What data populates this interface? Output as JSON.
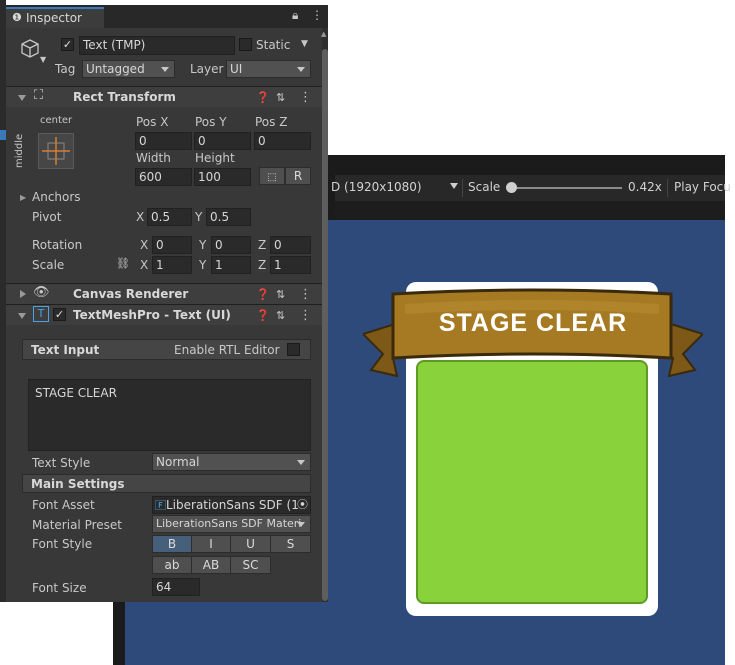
{
  "inspector": {
    "tab_label": "Inspector",
    "object": {
      "name": "Text (TMP)",
      "static_label": "Static",
      "tag_label": "Tag",
      "tag_value": "Untagged",
      "layer_label": "Layer",
      "layer_value": "UI"
    },
    "rect_transform": {
      "title": "Rect Transform",
      "anchor_h": "center",
      "anchor_v": "middle",
      "pos_x_label": "Pos X",
      "pos_y_label": "Pos Y",
      "pos_z_label": "Pos Z",
      "pos_x": "0",
      "pos_y": "0",
      "pos_z": "0",
      "width_label": "Width",
      "height_label": "Height",
      "width": "600",
      "height": "100",
      "r_button": "R",
      "anchors_label": "Anchors",
      "pivot_label": "Pivot",
      "pivot_x": "0.5",
      "pivot_y": "0.5",
      "rotation_label": "Rotation",
      "rot_x": "0",
      "rot_y": "0",
      "rot_z": "0",
      "scale_label": "Scale",
      "scale_x": "1",
      "scale_y": "1",
      "scale_z": "1",
      "x": "X",
      "y": "Y",
      "z": "Z"
    },
    "canvas_renderer": {
      "title": "Canvas Renderer"
    },
    "textmeshpro": {
      "title": "TextMeshPro - Text (UI)",
      "text_input_label": "Text Input",
      "rtl_label": "Enable RTL Editor",
      "text_value": "STAGE CLEAR",
      "text_style_label": "Text Style",
      "text_style_value": "Normal",
      "main_settings_label": "Main Settings",
      "font_asset_label": "Font Asset",
      "font_asset_value": "LiberationSans SDF (1",
      "material_preset_label": "Material Preset",
      "material_preset_value": "LiberationSans SDF Materi",
      "font_style_label": "Font Style",
      "font_style_row1": [
        "B",
        "I",
        "U",
        "S"
      ],
      "font_style_row2": [
        "ab",
        "AB",
        "SC"
      ],
      "font_size_label": "Font Size",
      "font_size_value": "64"
    }
  },
  "game_view": {
    "resolution": "D (1920x1080)",
    "scale_label": "Scale",
    "scale_value": "0.42x",
    "play_focus": "Play Focu",
    "banner_text": "STAGE CLEAR",
    "canvas_color": "#2e4a7a",
    "panel_color": "#8ad23b",
    "ribbon_color": "#a67a22"
  }
}
